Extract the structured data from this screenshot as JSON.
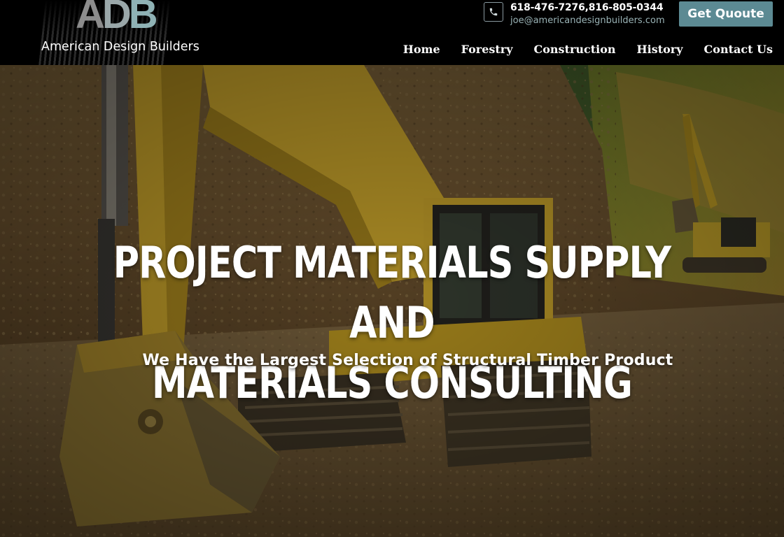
{
  "brand": {
    "logo_letters": [
      "A",
      "D",
      "B"
    ],
    "name": "American Design Builders"
  },
  "contact": {
    "icon": "phone-icon",
    "phone": "618-476-7276,816-805-0344",
    "email": "joe@americandesignbuilders.com"
  },
  "header": {
    "quote_button": "Get Quoute"
  },
  "nav": {
    "items": [
      {
        "label": "Home"
      },
      {
        "label": "Forestry"
      },
      {
        "label": "Construction"
      },
      {
        "label": "History"
      },
      {
        "label": "Contact Us"
      }
    ]
  },
  "hero": {
    "title_line1": "PROJECT MATERIALS SUPPLY AND",
    "title_line2": "MATERIALS CONSULTING",
    "subtitle": "We Have the Largest Selection of Structural Timber Product"
  },
  "colors": {
    "header_bg": "#000000",
    "accent_button": "#5c8a93",
    "email_text": "#9ab3b6"
  }
}
